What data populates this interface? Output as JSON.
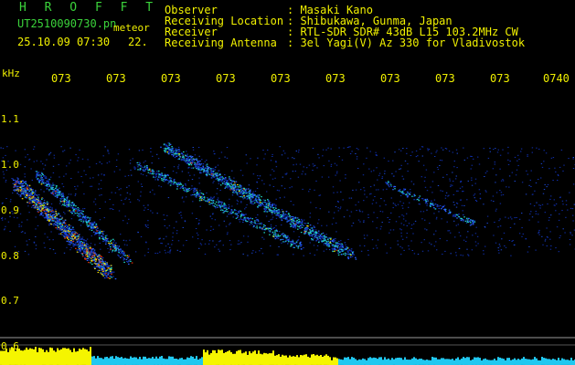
{
  "header": {
    "title": "H R O F F T",
    "filename": "UT2510090730.pn",
    "kind": "meteor",
    "date": "25.10.09 07:30",
    "frame": "22.",
    "info": [
      {
        "label": "Observer",
        "value": ": Masaki Kano"
      },
      {
        "label": "Receiving Location",
        "value": ": Shibukawa, Gunma, Japan"
      },
      {
        "label": "Receiver",
        "value": ": RTL-SDR SDR# 43dB L15 103.2MHz CW"
      },
      {
        "label": "Receiving Antenna",
        "value": ": 3el Yagi(V) Az 330 for Vladivostok"
      }
    ]
  },
  "axes": {
    "y_unit": "kHz",
    "y_ticks": [
      "1.1",
      "1.0",
      "0.9",
      "0.8",
      "0.7",
      "0.6"
    ],
    "x_ticks": [
      "073",
      "073",
      "073",
      "073",
      "073",
      "073",
      "073",
      "073",
      "073",
      "0740"
    ]
  },
  "colors": {
    "axis_text": "#f0f000",
    "header_green": "#3bd33b",
    "strong_echo": "#e03000",
    "medium_echo": "#22d0c0",
    "weak_echo": "#1030b0",
    "noise_bar_yellow": "#f5f500",
    "noise_bar_cyan": "#20c8f0"
  }
}
